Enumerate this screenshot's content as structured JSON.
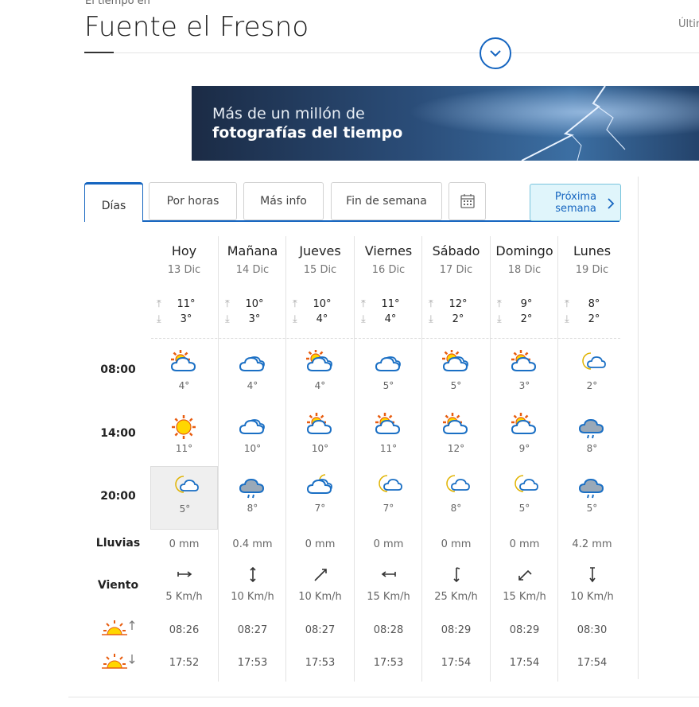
{
  "header": {
    "pre_title": "El tiempo en",
    "title": "Fuente el Fresno",
    "right_text": "Últim"
  },
  "banner": {
    "line1": "Más de un millón de",
    "line2": "fotografías del tiempo"
  },
  "tabs": {
    "dias": "Días",
    "por_horas": "Por horas",
    "mas_info": "Más info",
    "fin_semana": "Fin de semana",
    "proxima_1": "Próxima",
    "proxima_2": "semana"
  },
  "row_labels": {
    "h08": "08:00",
    "h14": "14:00",
    "h20": "20:00",
    "lluvias": "Lluvias",
    "viento": "Viento"
  },
  "days": [
    {
      "name": "Hoy",
      "date": "13 Dic",
      "max": "11°",
      "min": "3°",
      "t08": "4°",
      "t14": "11°",
      "t20": "5°",
      "i08": "sun-cloud-icon",
      "i14": "sun-icon",
      "i20": "moon-cloud-icon",
      "rain": "0 mm",
      "wind": "5 Km/h",
      "wind_dir": "west-east-icon",
      "sunrise": "08:26",
      "sunset": "17:52"
    },
    {
      "name": "Mañana",
      "date": "14 Dic",
      "max": "10°",
      "min": "3°",
      "t08": "4°",
      "t14": "10°",
      "t20": "8°",
      "i08": "cloudy-icon",
      "i14": "cloudy-icon",
      "i20": "drizzle-icon",
      "rain": "0.4 mm",
      "wind": "10 Km/h",
      "wind_dir": "north-south-icon",
      "sunrise": "08:27",
      "sunset": "17:53"
    },
    {
      "name": "Jueves",
      "date": "15 Dic",
      "max": "10°",
      "min": "4°",
      "t08": "4°",
      "t14": "10°",
      "t20": "7°",
      "i08": "sun-cloudy-icon",
      "i14": "sun-cloud-icon",
      "i20": "moon-cloudy-icon",
      "rain": "0 mm",
      "wind": "10 Km/h",
      "wind_dir": "northeast-icon",
      "sunrise": "08:27",
      "sunset": "17:53"
    },
    {
      "name": "Viernes",
      "date": "16 Dic",
      "max": "11°",
      "min": "4°",
      "t08": "5°",
      "t14": "11°",
      "t20": "7°",
      "i08": "cloudy-icon",
      "i14": "sun-cloud-icon",
      "i20": "moon-cloud-icon",
      "rain": "0 mm",
      "wind": "15 Km/h",
      "wind_dir": "west-icon",
      "sunrise": "08:28",
      "sunset": "17:53"
    },
    {
      "name": "Sábado",
      "date": "17 Dic",
      "max": "12°",
      "min": "2°",
      "t08": "5°",
      "t14": "12°",
      "t20": "8°",
      "i08": "sun-cloudy-icon",
      "i14": "sun-cloud-icon",
      "i20": "moon-cloud-icon",
      "rain": "0 mm",
      "wind": "25 Km/h",
      "wind_dir": "north-icon",
      "sunrise": "08:29",
      "sunset": "17:54"
    },
    {
      "name": "Domingo",
      "date": "18 Dic",
      "max": "9°",
      "min": "2°",
      "t08": "3°",
      "t14": "9°",
      "t20": "5°",
      "i08": "sun-cloud-icon",
      "i14": "sun-cloud-icon",
      "i20": "moon-cloud-icon",
      "rain": "0 mm",
      "wind": "15 Km/h",
      "wind_dir": "southwest-icon",
      "sunrise": "08:29",
      "sunset": "17:54"
    },
    {
      "name": "Lunes",
      "date": "19 Dic",
      "max": "8°",
      "min": "2°",
      "t08": "2°",
      "t14": "8°",
      "t20": "5°",
      "i08": "moon-cloud-icon",
      "i14": "drizzle-icon",
      "i20": "drizzle-icon",
      "rain": "4.2 mm",
      "wind": "10 Km/h",
      "wind_dir": "south-icon",
      "sunrise": "08:30",
      "sunset": "17:54"
    }
  ]
}
